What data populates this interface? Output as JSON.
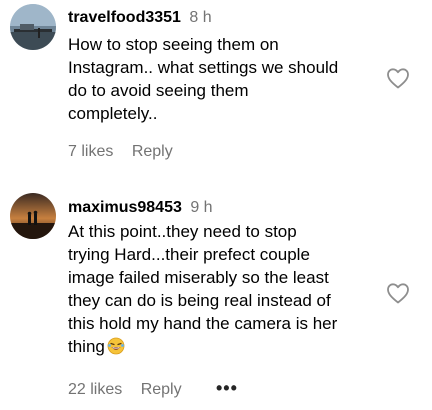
{
  "comments": [
    {
      "username": "travelfood3351",
      "time": "8 h",
      "lines": [
        "How to stop seeing them on",
        "Instagram.. what settings we should",
        "do to avoid seeing them",
        "completely.."
      ],
      "likes": "7 likes",
      "reply_label": "Reply",
      "avatar_icon": "avatar-photo-pier"
    },
    {
      "username": "maximus98453",
      "time": "9 h",
      "lines": [
        "At this point..they need to stop",
        "trying Hard...their prefect couple",
        "image failed miserably so the least",
        "they can do is being real instead of",
        "this hold my hand the camera is her",
        "thing"
      ],
      "emoji_icon": "rolling-laughing-emoji",
      "likes": "22 likes",
      "reply_label": "Reply",
      "more_label": "•••",
      "avatar_icon": "avatar-photo-sunset"
    }
  ],
  "colors": {
    "meta_gray": "#737373",
    "text": "#000000",
    "heart_outline": "#8e8e8e"
  }
}
